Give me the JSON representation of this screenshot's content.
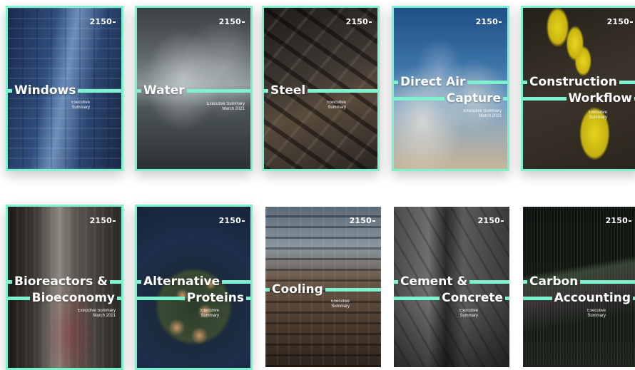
{
  "brand": "2150",
  "cards": [
    {
      "title_lines": [
        "Windows"
      ],
      "subtitle": [
        "Executive",
        "Summary"
      ]
    },
    {
      "title_lines": [
        "Water"
      ],
      "subtitle": [
        "Executive Summary",
        "March 2021"
      ]
    },
    {
      "title_lines": [
        "Steel"
      ],
      "subtitle": [
        "Executive",
        "Summary"
      ]
    },
    {
      "title_lines": [
        "Direct Air",
        "Capture"
      ],
      "subtitle": [
        "Executive Summary",
        "March 2021"
      ]
    },
    {
      "title_lines": [
        "Construction",
        "Workflow"
      ],
      "subtitle": [
        "Executive",
        "Summary"
      ]
    },
    {
      "title_lines": [
        "Bioreactors &",
        "Bioeconomy"
      ],
      "subtitle": [
        "Executive Summary",
        "March 2021"
      ]
    },
    {
      "title_lines": [
        "Alternative",
        "Proteins"
      ],
      "subtitle": [
        "Executive",
        "Summary"
      ]
    },
    {
      "title_lines": [
        "Cooling"
      ],
      "subtitle": [
        "Executive",
        "Summary"
      ]
    },
    {
      "title_lines": [
        "Cement &",
        "Concrete"
      ],
      "subtitle": [
        "Executive",
        "Summary"
      ]
    },
    {
      "title_lines": [
        "Carbon",
        "Accounting"
      ],
      "subtitle": [
        "Executive",
        "Summary"
      ]
    }
  ]
}
